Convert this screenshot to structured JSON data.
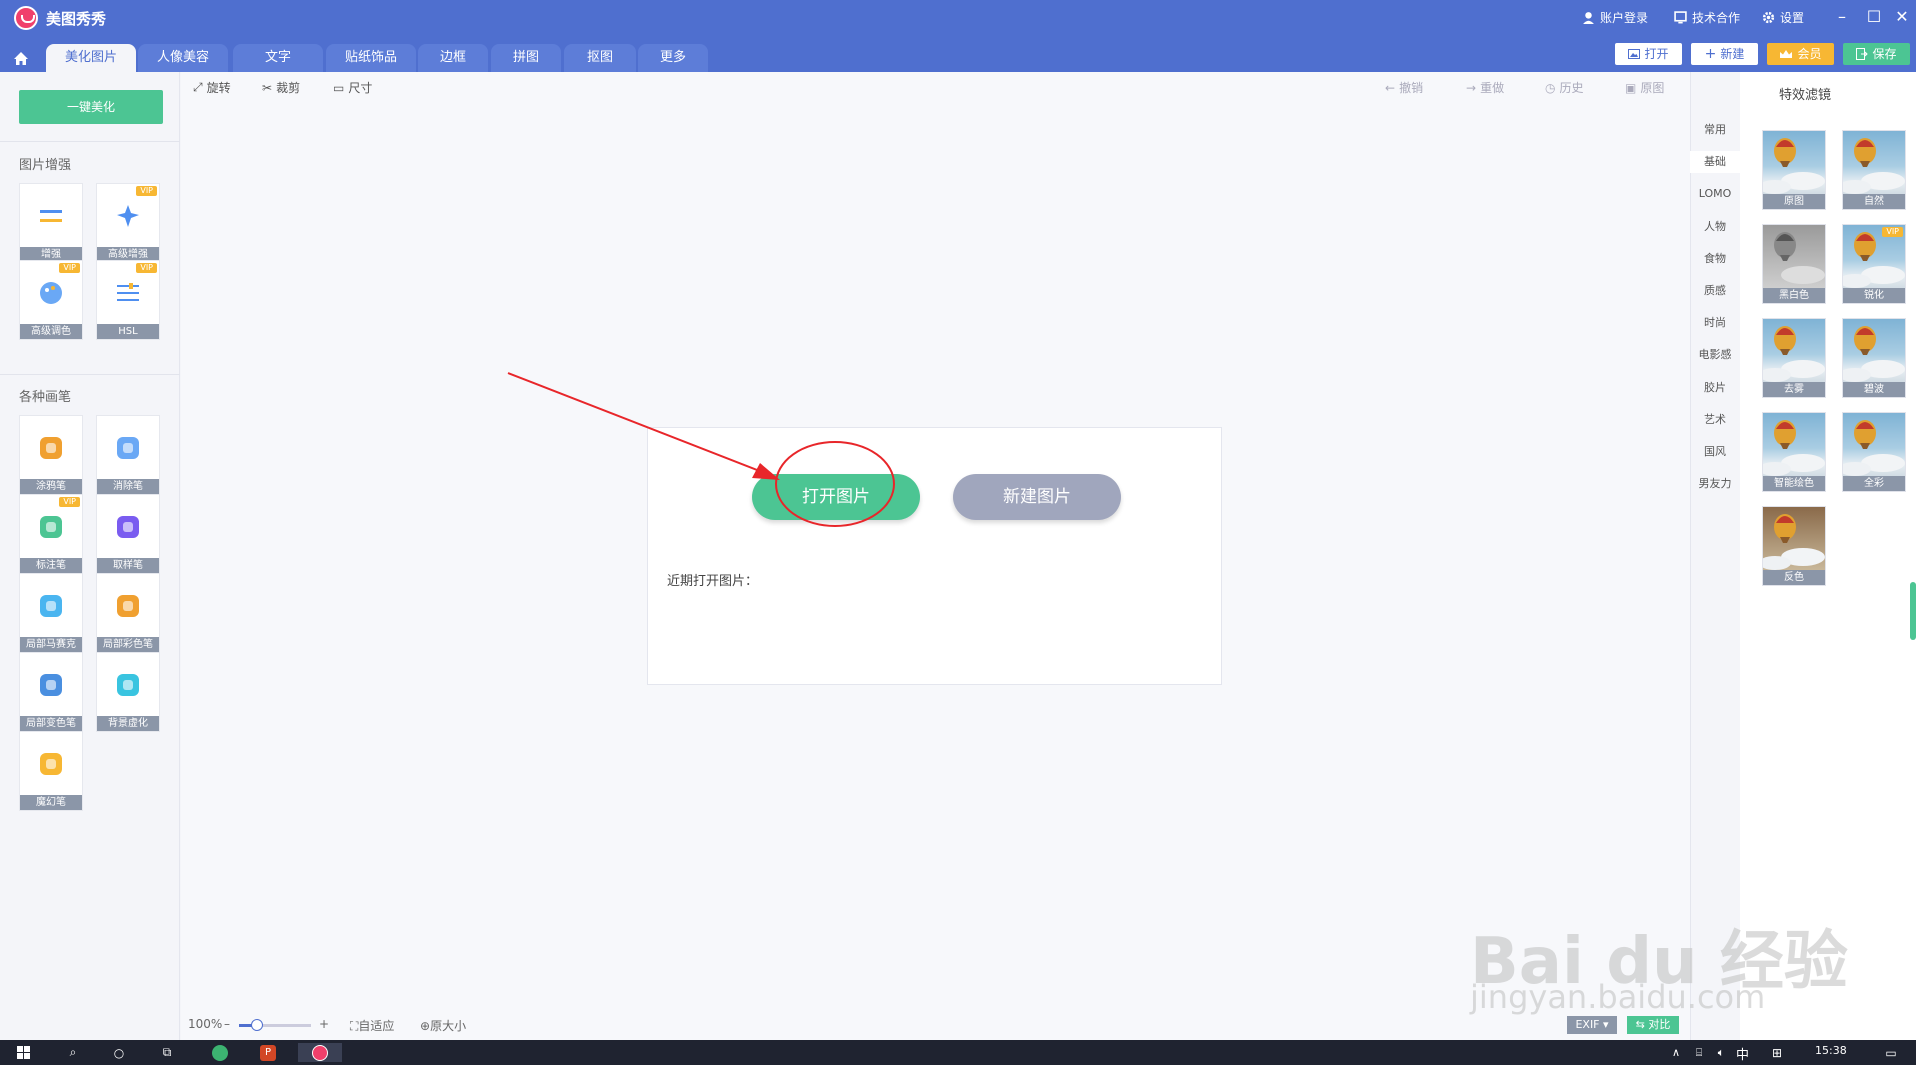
{
  "app": {
    "title": "美图秀秀"
  },
  "titlebar": {
    "account": "账户登录",
    "cooperation": "技术合作",
    "settings": "设置"
  },
  "tabs": [
    "美化图片",
    "人像美容",
    "文字",
    "贴纸饰品",
    "边框",
    "拼图",
    "抠图",
    "更多"
  ],
  "header_buttons": {
    "open": "打开",
    "new": "新建",
    "vip": "会员",
    "save": "保存"
  },
  "toolbar": {
    "rotate": "旋转",
    "crop": "裁剪",
    "size": "尺寸",
    "undo": "撤销",
    "redo": "重做",
    "history": "历史",
    "original": "原图"
  },
  "left": {
    "one_key": "一键美化",
    "section_enhance": "图片增强",
    "enhance_tools": [
      {
        "label": "增强",
        "vip": ""
      },
      {
        "label": "高级增强",
        "vip": "VIP"
      },
      {
        "label": "高级调色",
        "vip": "VIP"
      },
      {
        "label": "HSL",
        "vip": "VIP"
      }
    ],
    "section_brush": "各种画笔",
    "brush_tools": [
      {
        "label": "涂鸦笔",
        "vip": ""
      },
      {
        "label": "消除笔",
        "vip": ""
      },
      {
        "label": "标注笔",
        "vip": "VIP"
      },
      {
        "label": "取样笔",
        "vip": ""
      },
      {
        "label": "局部马赛克",
        "vip": ""
      },
      {
        "label": "局部彩色笔",
        "vip": ""
      },
      {
        "label": "局部变色笔",
        "vip": ""
      },
      {
        "label": "背景虚化",
        "vip": ""
      },
      {
        "label": "魔幻笔",
        "vip": ""
      }
    ]
  },
  "dialog": {
    "open_button": "打开图片",
    "new_button": "新建图片",
    "recent_label": "近期打开图片："
  },
  "status": {
    "zoom": "100%",
    "zoom_level": 0.25,
    "fit": "自适应",
    "actual": "原大小",
    "exif": "EXIF",
    "compare": "对比"
  },
  "filters": {
    "title": "特效滤镜",
    "categories": [
      "常用",
      "基础",
      "LOMO",
      "人物",
      "食物",
      "质感",
      "时尚",
      "电影感",
      "胶片",
      "艺术",
      "国风",
      "男友力"
    ],
    "items": [
      {
        "label": "原图",
        "vip": ""
      },
      {
        "label": "自然",
        "vip": ""
      },
      {
        "label": "黑白色",
        "vip": ""
      },
      {
        "label": "锐化",
        "vip": "VIP"
      },
      {
        "label": "去雾",
        "vip": ""
      },
      {
        "label": "碧波",
        "vip": ""
      },
      {
        "label": "智能绘色",
        "vip": ""
      },
      {
        "label": "全彩",
        "vip": ""
      },
      {
        "label": "反色",
        "vip": ""
      }
    ]
  },
  "taskbar": {
    "ime": "中",
    "time": "15:38"
  },
  "watermark": {
    "text": "Bai du 经验",
    "url": "jingyan.baidu.com"
  },
  "colors": {
    "primary": "#4f6fcf",
    "green": "#4cc593",
    "annotation_red": "#e8262a"
  }
}
